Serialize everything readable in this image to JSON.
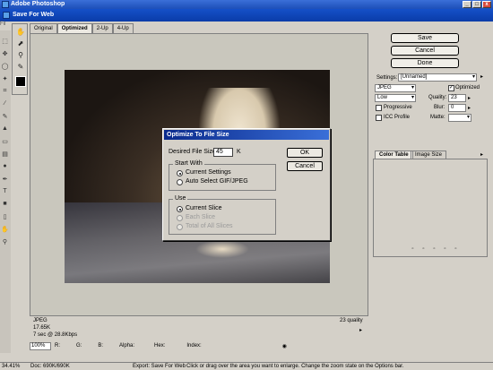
{
  "app": {
    "title": "Adobe Photoshop",
    "dialog_title": "Save For Web",
    "menu_fragment": "Fil"
  },
  "tabs": [
    {
      "label": "Original"
    },
    {
      "label": "Optimized"
    },
    {
      "label": "2-Up"
    },
    {
      "label": "4-Up"
    }
  ],
  "preview_status": {
    "format": "JPEG",
    "size": "17.65K",
    "time": "7 sec @ 28.8Kbps",
    "quality_text": "23 quality"
  },
  "bottom_bar": {
    "zoom": "100%",
    "r": "R:",
    "g": "G:",
    "b": "B:",
    "alpha": "Alpha:",
    "hex": "Hex:",
    "index": "Index:"
  },
  "right_buttons": {
    "save": "Save",
    "cancel": "Cancel",
    "done": "Done"
  },
  "settings": {
    "label": "Settings:",
    "preset": "[Unnamed]",
    "format": "JPEG",
    "quality_level": "Low",
    "optimized_label": "Optimized",
    "quality_label": "Quality:",
    "quality_value": "23",
    "progressive_label": "Progressive",
    "blur_label": "Blur:",
    "blur_value": "0",
    "icc_label": "ICC Profile",
    "matte_label": "Matte:"
  },
  "color_table": {
    "tab1": "Color Table",
    "tab2": "Image Size"
  },
  "ps_status": {
    "zoom": "34.41%",
    "doc": "Doc: 690K/690K",
    "export": "Export: Save For Web",
    "hint": "Click or drag over the area you want to enlarge. Change the zoom state on the Options bar."
  },
  "modal": {
    "title": "Optimize To File Size",
    "size_label": "Desired File Size:",
    "size_value": "45",
    "size_unit": "K",
    "ok": "OK",
    "cancel": "Cancel",
    "start_with_title": "Start With",
    "current_settings": "Current Settings",
    "auto_select": "Auto Select GIF/JPEG",
    "use_title": "Use",
    "current_slice": "Current Slice",
    "each_slice": "Each Slice",
    "total_slices": "Total of All Slices"
  },
  "colors": {
    "arrow": "#e8141c",
    "title_bar": "#1550c8"
  }
}
